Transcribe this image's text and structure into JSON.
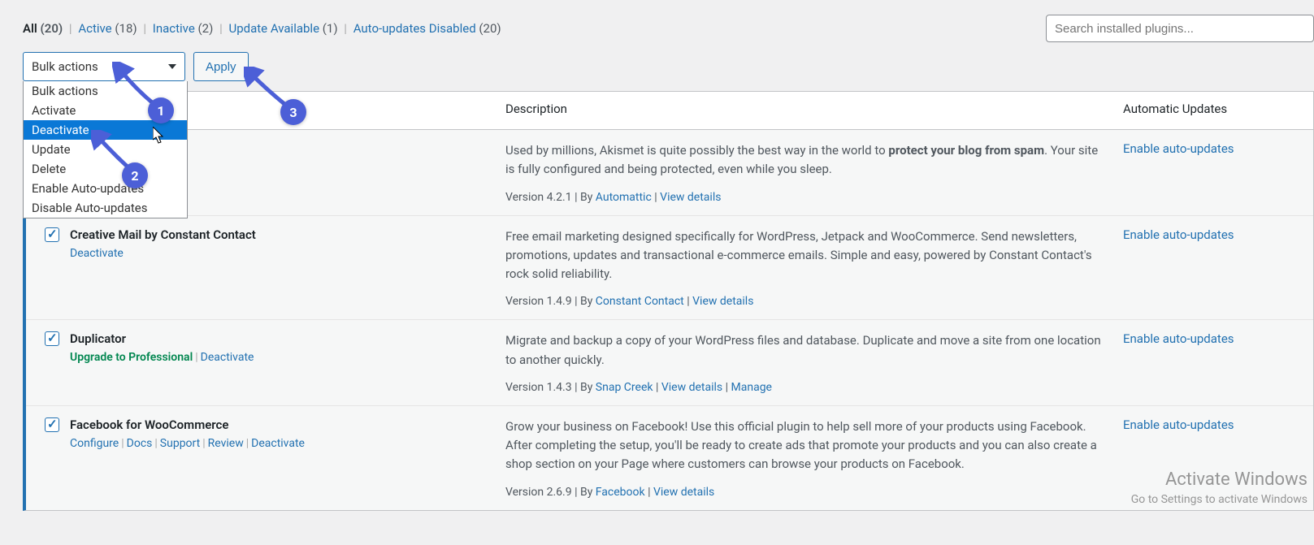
{
  "filters": {
    "all_label": "All",
    "all_count": "(20)",
    "active_label": "Active",
    "active_count": "(18)",
    "inactive_label": "Inactive",
    "inactive_count": "(2)",
    "update_label": "Update Available",
    "update_count": "(1)",
    "autodis_label": "Auto-updates Disabled",
    "autodis_count": "(20)"
  },
  "search_placeholder": "Search installed plugins...",
  "bulk": {
    "selected": "Bulk actions",
    "options": {
      "o0": "Bulk actions",
      "o1": "Activate",
      "o2": "Deactivate",
      "o3": "Update",
      "o4": "Delete",
      "o5": "Enable Auto-updates",
      "o6": "Disable Auto-updates"
    },
    "apply": "Apply"
  },
  "headers": {
    "desc": "Description",
    "auto": "Automatic Updates"
  },
  "rows": {
    "r1": {
      "desc_pre": "Used by millions, Akismet is quite possibly the best way in the world to ",
      "desc_bold": "protect your blog from spam",
      "desc_post": ". Your site is fully configured and being protected, even while you sleep.",
      "version": "Version 4.2.1",
      "by": "By ",
      "author": "Automattic",
      "view": "View details",
      "auto": "Enable auto-updates"
    },
    "r2": {
      "name": "Creative Mail by Constant Contact",
      "deactivate": "Deactivate",
      "desc": "Free email marketing designed specifically for WordPress, Jetpack and WooCommerce. Send newsletters, promotions, updates and transactional e-commerce emails. Simple and easy, powered by Constant Contact's rock solid reliability.",
      "version": "Version 1.4.9",
      "by": "By ",
      "author": "Constant Contact",
      "view": "View details",
      "auto": "Enable auto-updates"
    },
    "r3": {
      "name": "Duplicator",
      "upgrade": "Upgrade to Professional",
      "deactivate": "Deactivate",
      "desc": "Migrate and backup a copy of your WordPress files and database. Duplicate and move a site from one location to another quickly.",
      "version": "Version 1.4.3",
      "by": "By ",
      "author": "Snap Creek",
      "view": "View details",
      "manage": "Manage",
      "auto": "Enable auto-updates"
    },
    "r4": {
      "name": "Facebook for WooCommerce",
      "a1": "Configure",
      "a2": "Docs",
      "a3": "Support",
      "a4": "Review",
      "a5": "Deactivate",
      "desc": "Grow your business on Facebook! Use this official plugin to help sell more of your products using Facebook. After completing the setup, you'll be ready to create ads that promote your products and you can also create a shop section on your Page where customers can browse your products on Facebook.",
      "version": "Version 2.6.9",
      "by": "By ",
      "author": "Facebook",
      "view": "View details",
      "auto": "Enable auto-updates"
    }
  },
  "badges": {
    "b1": "1",
    "b2": "2",
    "b3": "3"
  },
  "watermark": {
    "title": "Activate Windows",
    "sub": "Go to Settings to activate Windows"
  }
}
